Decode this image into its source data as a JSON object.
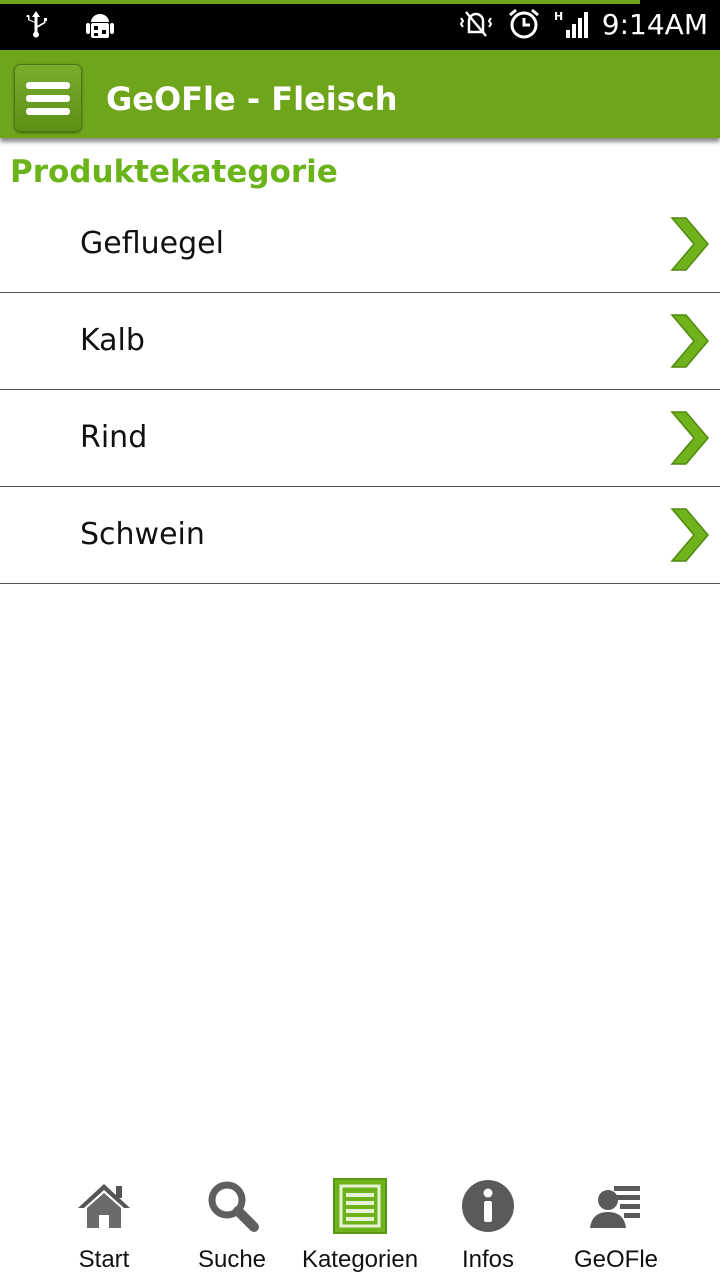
{
  "status_bar": {
    "time": "9:14AM",
    "icons_left": [
      "usb-icon",
      "android-debug-icon"
    ],
    "icons_right": [
      "vibrate-mute-icon",
      "alarm-icon",
      "signal-icon"
    ]
  },
  "action_bar": {
    "menu_icon": "hamburger-menu-icon",
    "title": "GeOFle - Fleisch"
  },
  "section_header": "Produktekategorie",
  "categories": [
    {
      "label": "Gefluegel"
    },
    {
      "label": "Kalb"
    },
    {
      "label": "Rind"
    },
    {
      "label": "Schwein"
    }
  ],
  "bottom_nav": {
    "items": [
      {
        "label": "Start",
        "icon": "home-icon"
      },
      {
        "label": "Suche",
        "icon": "search-icon"
      },
      {
        "label": "Kategorien",
        "icon": "list-icon",
        "active": true
      },
      {
        "label": "Infos",
        "icon": "info-icon"
      },
      {
        "label": "GeOFle",
        "icon": "contact-icon"
      }
    ]
  },
  "colors": {
    "accent": "#6fa51b",
    "header_text": "#6ab41a",
    "status_bar": "#000000"
  }
}
